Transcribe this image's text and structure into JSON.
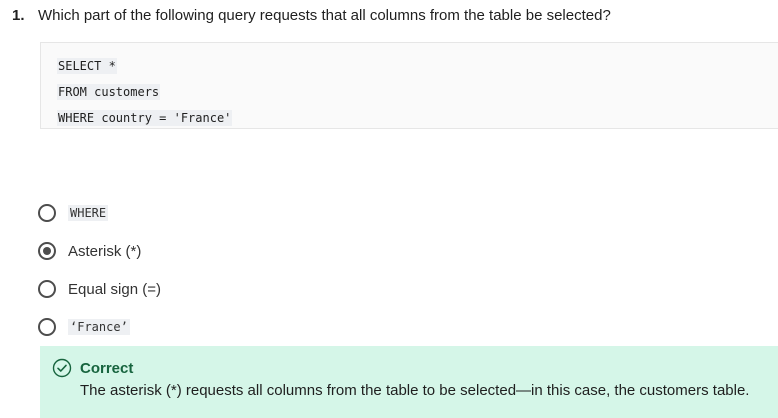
{
  "question": {
    "number": "1.",
    "text": "Which part of the following query requests that all columns from the table be selected?"
  },
  "code": {
    "lines": [
      "SELECT *",
      "FROM customers",
      "WHERE country = 'France'"
    ]
  },
  "options": [
    {
      "label": "WHERE",
      "selected": false
    },
    {
      "label": "Asterisk (*)",
      "selected": true
    },
    {
      "label": "Equal sign (=)",
      "selected": false
    },
    {
      "label": "‘France’",
      "selected": false
    }
  ],
  "feedback": {
    "title": "Correct",
    "text": "The asterisk (*) requests all columns from the table to be selected—in this case, the customers table.",
    "icon": "check-circle-icon",
    "background": "#d5f6e8",
    "accent": "#17643e"
  }
}
